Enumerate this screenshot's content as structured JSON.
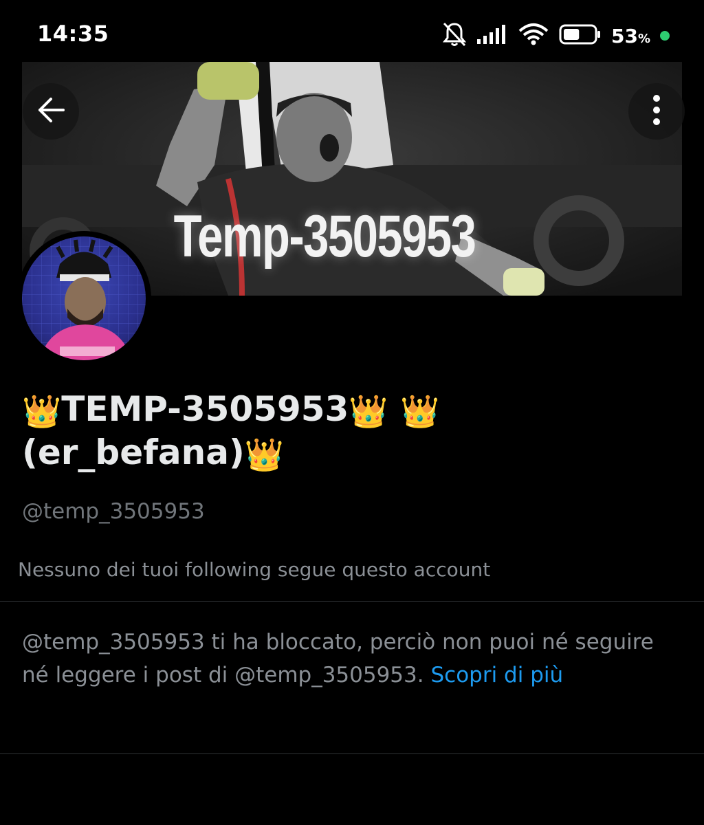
{
  "status_bar": {
    "time": "14:35",
    "battery_percent": "53",
    "battery_unit": "%",
    "battery_level": 0.53,
    "icons": [
      "bell-off-icon",
      "signal-icon",
      "wifi-icon",
      "battery-icon",
      "charging-dot-icon"
    ],
    "dot_color": "#2ecc71"
  },
  "header": {
    "back_icon": "arrow-left-icon",
    "more_icon": "more-vertical-icon"
  },
  "banner": {
    "overlay_text": "Temp-3505953"
  },
  "profile": {
    "display_name_main": "TEMP-3505953",
    "display_name_sub": "(er_befana)",
    "crown_glyph": "👑",
    "handle": "@temp_3505953",
    "following_note": "Nessuno dei tuoi following segue questo account"
  },
  "blocked": {
    "message": "@temp_3505953 ti ha bloccato, perciò non puoi né seguire né leggere i post di @temp_3505953.",
    "learn_more": "Scopri di più"
  },
  "colors": {
    "background": "#000000",
    "link": "#1d9bf0",
    "secondary_text": "#71767b",
    "divider": "#2f3336"
  }
}
